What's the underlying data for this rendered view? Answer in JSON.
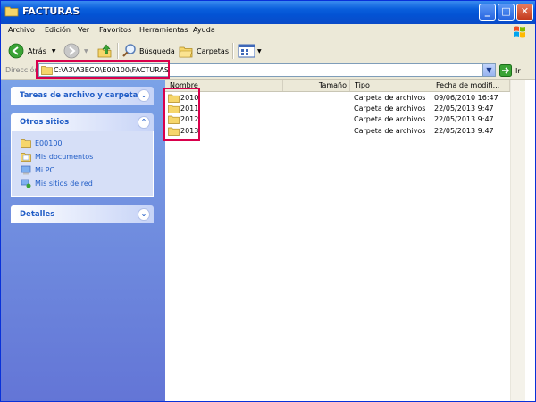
{
  "window": {
    "title": "FACTURAS",
    "minimize": "_",
    "maximize": "□",
    "close": "✕"
  },
  "menu": [
    "Archivo",
    "Edición",
    "Ver",
    "Favoritos",
    "Herramientas",
    "Ayuda"
  ],
  "toolbar": {
    "back_label": "Atrás",
    "search_label": "Búsqueda",
    "folders_label": "Carpetas"
  },
  "address": {
    "label": "Dirección",
    "path": "C:\\A3\\A3ECO\\E00100\\FACTURAS",
    "go_label": "Ir"
  },
  "tasks": {
    "file_tasks_title": "Tareas de archivo y carpeta",
    "other_places_title": "Otros sitios",
    "other_places": [
      {
        "label": "E00100",
        "icon": "folder-icon"
      },
      {
        "label": "Mis documentos",
        "icon": "my-documents-icon"
      },
      {
        "label": "Mi PC",
        "icon": "my-computer-icon"
      },
      {
        "label": "Mis sitios de red",
        "icon": "network-places-icon"
      }
    ],
    "details_title": "Detalles"
  },
  "columns": {
    "name": "Nombre",
    "size": "Tamaño",
    "type": "Tipo",
    "date": "Fecha de modifi..."
  },
  "files": [
    {
      "name": "2010",
      "size": "",
      "type": "Carpeta de archivos",
      "date": "09/06/2010 16:47"
    },
    {
      "name": "2011",
      "size": "",
      "type": "Carpeta de archivos",
      "date": "22/05/2013 9:47"
    },
    {
      "name": "2012",
      "size": "",
      "type": "Carpeta de archivos",
      "date": "22/05/2013 9:47"
    },
    {
      "name": "2013",
      "size": "",
      "type": "Carpeta de archivos",
      "date": "22/05/2013 9:47"
    }
  ],
  "colors": {
    "highlight": "#d9004c",
    "link": "#215dc6",
    "titlebar": "#0a5fdc"
  }
}
